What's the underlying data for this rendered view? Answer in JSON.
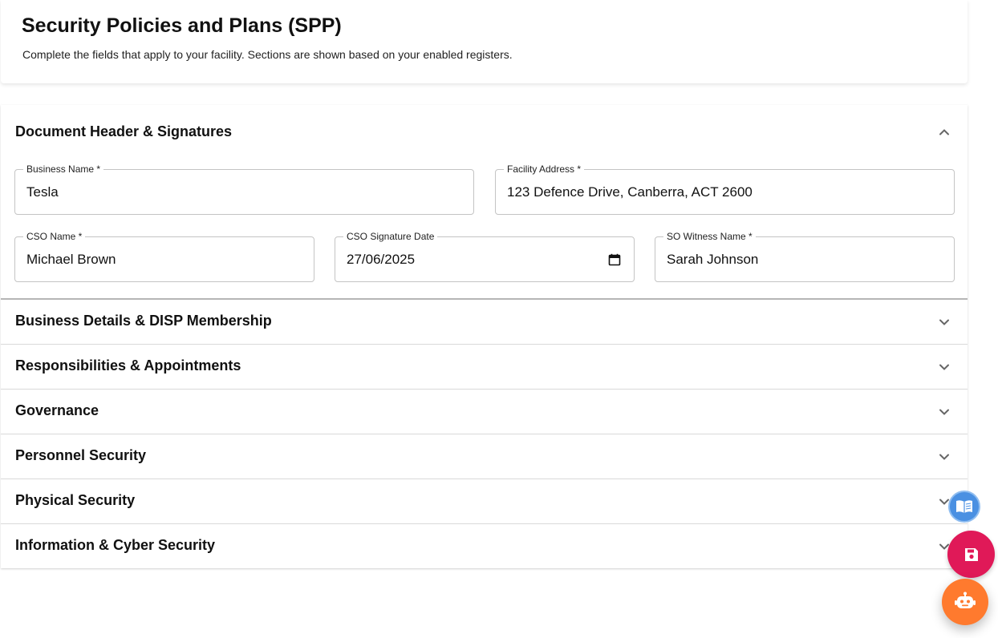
{
  "header": {
    "title": "Security Policies and Plans (SPP)",
    "subtitle": "Complete the fields that apply to your facility. Sections are shown based on your enabled registers."
  },
  "expanded_section": {
    "title": "Document Header & Signatures",
    "fields": {
      "business_name": {
        "label": "Business Name *",
        "value": "Tesla"
      },
      "facility_address": {
        "label": "Facility Address *",
        "value": "123 Defence Drive, Canberra, ACT 2600"
      },
      "cso_name": {
        "label": "CSO Name *",
        "value": "Michael Brown"
      },
      "cso_signature_date": {
        "label": "CSO Signature Date",
        "value": "27/06/2025"
      },
      "so_witness_name": {
        "label": "SO Witness Name *",
        "value": "Sarah Johnson"
      }
    }
  },
  "collapsed_sections": [
    {
      "title": "Business Details & DISP Membership"
    },
    {
      "title": "Responsibilities & Appointments"
    },
    {
      "title": "Governance"
    },
    {
      "title": "Personnel Security"
    },
    {
      "title": "Physical Security"
    },
    {
      "title": "Information & Cyber Security"
    }
  ],
  "fabs": {
    "guide_icon": "open-book-icon",
    "save_icon": "floppy-disk-icon",
    "bot_icon": "robot-icon",
    "colors": {
      "guide": "#4a90e2",
      "save": "#e01958",
      "bot": "#ff7a2e"
    }
  }
}
